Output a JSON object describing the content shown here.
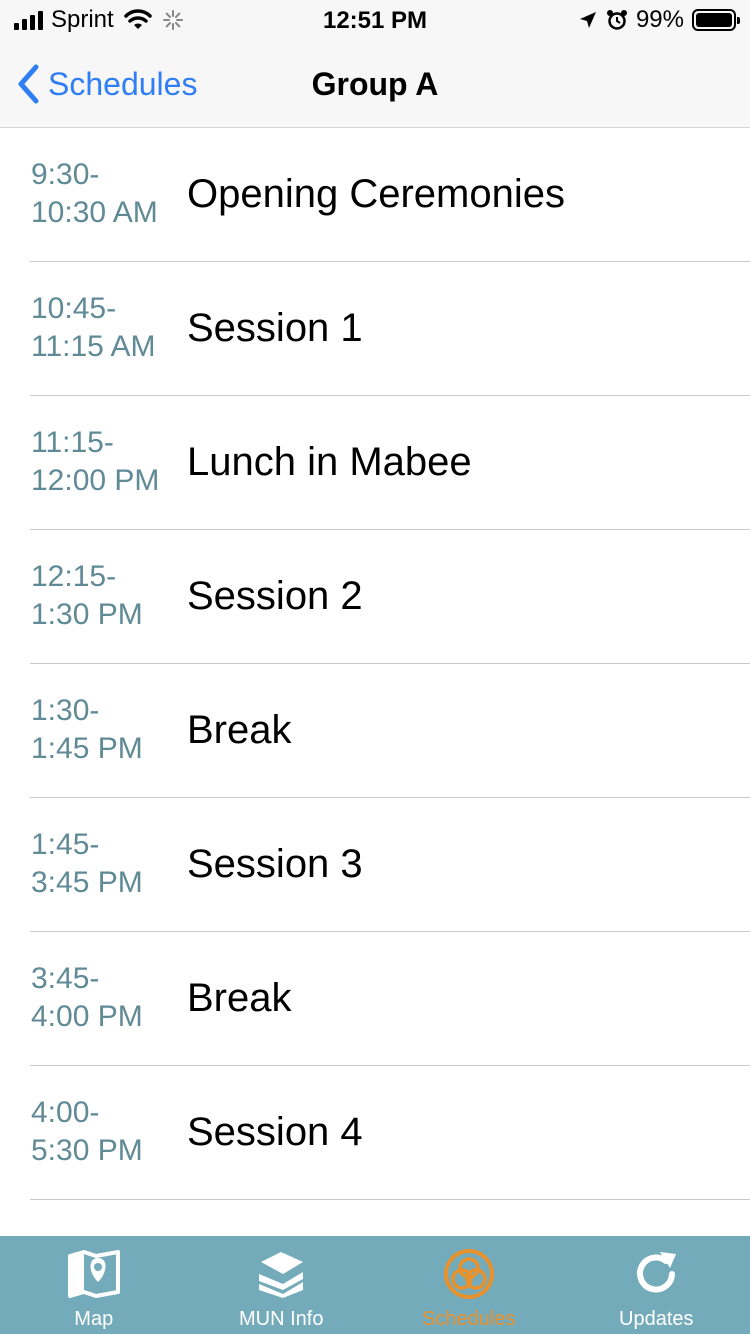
{
  "status_bar": {
    "carrier": "Sprint",
    "time": "12:51 PM",
    "battery": "99%",
    "battery_level": 0.99
  },
  "nav": {
    "back_label": "Schedules",
    "title": "Group A"
  },
  "schedule": [
    {
      "time_start": "9:30-",
      "time_end": "10:30 AM",
      "title": "Opening Ceremonies"
    },
    {
      "time_start": "10:45-",
      "time_end": "11:15 AM",
      "title": "Session 1"
    },
    {
      "time_start": "11:15-",
      "time_end": "12:00 PM",
      "title": "Lunch in Mabee"
    },
    {
      "time_start": "12:15-",
      "time_end": "1:30 PM",
      "title": "Session 2"
    },
    {
      "time_start": "1:30-",
      "time_end": "1:45 PM",
      "title": "Break"
    },
    {
      "time_start": "1:45-",
      "time_end": "3:45 PM",
      "title": "Session 3"
    },
    {
      "time_start": "3:45-",
      "time_end": "4:00 PM",
      "title": "Break"
    },
    {
      "time_start": "4:00-",
      "time_end": "5:30 PM",
      "title": "Session 4"
    }
  ],
  "tab_bar": {
    "tabs": [
      {
        "label": "Map",
        "icon": "map-icon"
      },
      {
        "label": "MUN Info",
        "icon": "books-icon"
      },
      {
        "label": "Schedules",
        "icon": "schedules-icon",
        "active": true
      },
      {
        "label": "Updates",
        "icon": "refresh-icon"
      }
    ]
  },
  "colors": {
    "accent_blue": "#2f7ef6",
    "time_text": "#5f8a96",
    "tab_bar_bg": "#74abba",
    "tab_active": "#e8922e"
  }
}
